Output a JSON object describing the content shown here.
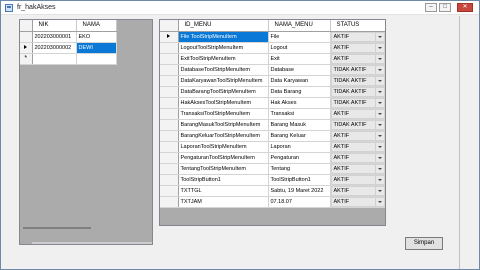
{
  "window": {
    "title": "fr_hakAkses",
    "minimize": "–",
    "maximize": "□",
    "close": "✕"
  },
  "users_grid": {
    "columns": [
      "NIK",
      "NAMA"
    ],
    "rows": [
      {
        "nik": "202203000001",
        "nama": "EKO"
      },
      {
        "nik": "202203000002",
        "nama": "DEWI"
      }
    ],
    "new_row_marker": "*"
  },
  "menu_grid": {
    "columns": [
      "ID_MENU",
      "NAMA_MENU",
      "STATUS"
    ],
    "rows": [
      {
        "id": "File ToolStripMenuItem",
        "name": "File",
        "status": "AKTIF"
      },
      {
        "id": "LogoutToolStripMenuItem",
        "name": "Logout",
        "status": "AKTIF"
      },
      {
        "id": "ExitToolStripMenuItem",
        "name": "Exit",
        "status": "AKTIF"
      },
      {
        "id": "DatabaseToolStripMenuItem",
        "name": "Database",
        "status": "TIDAK AKTIF"
      },
      {
        "id": "DataKaryawanToolStripMenuItem",
        "name": "Data Karyawan",
        "status": "TIDAK AKTIF"
      },
      {
        "id": "DataBarangToolStripMenuItem",
        "name": "Data Barang",
        "status": "TIDAK AKTIF"
      },
      {
        "id": "HakAksesToolStripMenuItem",
        "name": "Hak Akses",
        "status": "TIDAK AKTIF"
      },
      {
        "id": "TransaksiToolStripMenuItem",
        "name": "Transaksi",
        "status": "AKTIF"
      },
      {
        "id": "BarangMasukToolStripMenuItem",
        "name": "Barang Masuk",
        "status": "TIDAK AKTIF"
      },
      {
        "id": "BarangKeluarToolStripMenuItem",
        "name": "Barang Keluar",
        "status": "AKTIF"
      },
      {
        "id": "LaporanToolStripMenuItem",
        "name": "Laporan",
        "status": "AKTIF"
      },
      {
        "id": "PengaturanToolStripMenuItem",
        "name": "Pengaturan",
        "status": "AKTIF"
      },
      {
        "id": "TentangToolStripMenuItem",
        "name": "Tentang",
        "status": "AKTIF"
      },
      {
        "id": "ToolStripButton1",
        "name": "ToolStripButton1",
        "status": "AKTIF"
      },
      {
        "id": "TXTTGL",
        "name": "Sabtu, 19 Maret 2022",
        "status": "AKTIF"
      },
      {
        "id": "TXTJAM",
        "name": "07.18.07",
        "status": "AKTIF"
      }
    ]
  },
  "actions": {
    "save_label": "Simpan"
  },
  "colors": {
    "selection": "#0a78d7",
    "title_background": "#ffffff",
    "close_button": "#c9463d"
  }
}
